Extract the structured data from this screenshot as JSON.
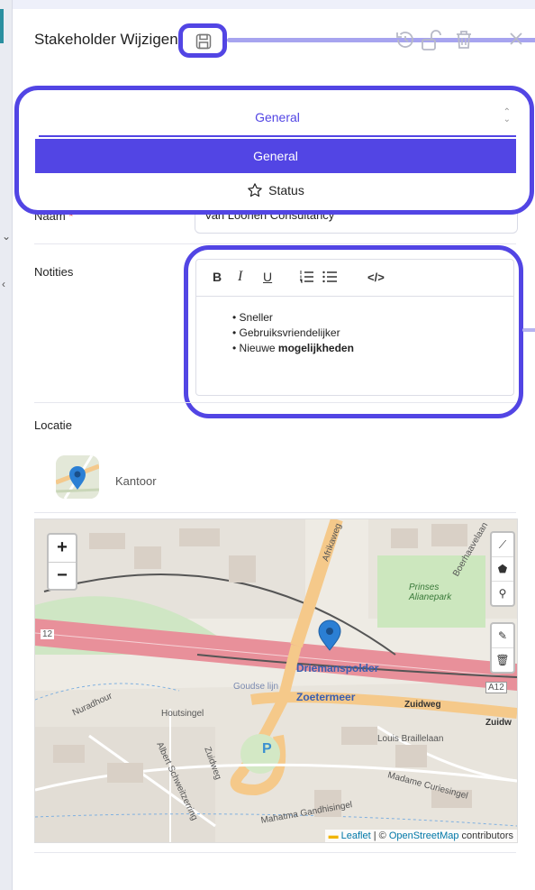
{
  "header": {
    "title": "Stakeholder Wijzigen"
  },
  "tabs": {
    "selected": "General",
    "options": [
      "General",
      "Status"
    ]
  },
  "form": {
    "naam_label": "Naam",
    "naam_required_mark": "*",
    "naam_value": "Van Loonen Consultancy",
    "notities_label": "Notities",
    "notities_items": [
      "Sneller",
      "Gebruiksvriendelijker",
      "Nieuwe "
    ],
    "notities_bold": "mogelijkheden",
    "toolbar": {
      "bold": "B",
      "italic": "I",
      "underline": "U",
      "code": "</>"
    },
    "locatie_label": "Locatie",
    "location_name": "Kantoor"
  },
  "map": {
    "zoom_in": "+",
    "zoom_out": "−",
    "labels": {
      "driemanspolder": "Driemanspolder",
      "zoetermeer": "Zoetermeer",
      "zuidweg": "Zuidweg",
      "zuidw": "Zuidw",
      "a12_left": "12",
      "a12_right": "A12",
      "afrikaweg": "Afrikaweg",
      "boerhaavelaan": "Boerhaavelaan",
      "prinses_alianepark": "Prinses Alianepark",
      "houtsingel": "Houtsingel",
      "goudse_lijn": "Goudse lijn",
      "zuidweg_curve": "Zuidweg",
      "nuradhour": "Nuradhour",
      "louis_braillelaan": "Louis Braillelaan",
      "madame_curiesingel": "Madame Curiesingel",
      "mahatma_gandhisingel": "Mahatma Gandhisingel",
      "albert_schweitzerring": "Albert Schweitzerring",
      "parking": "P"
    },
    "attribution": {
      "leaflet": "Leaflet",
      "separator": " | © ",
      "osm": "OpenStreetMap",
      "suffix": " contributors"
    }
  },
  "colors": {
    "accent": "#5245e4",
    "marker": "#2b7fd4"
  }
}
